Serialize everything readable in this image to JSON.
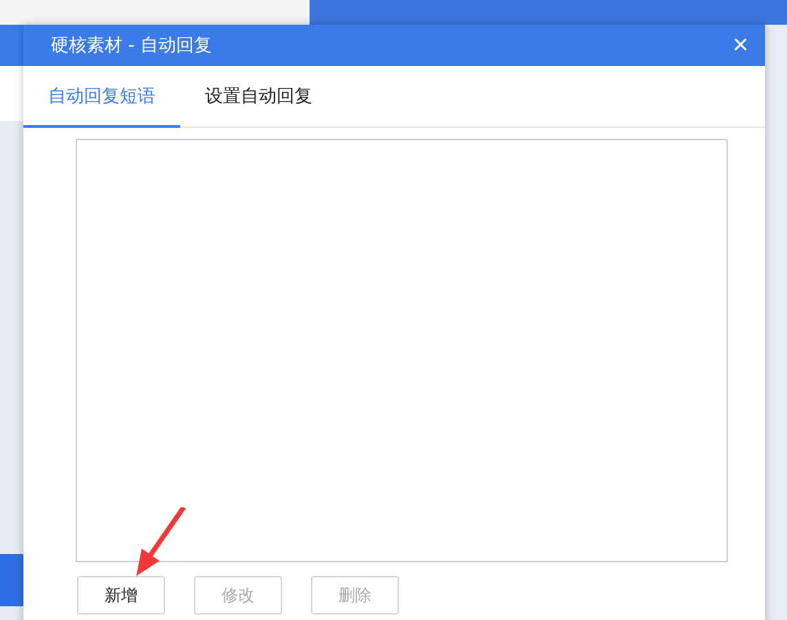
{
  "dialog": {
    "title": "硬核素材 - 自动回复",
    "close": "×"
  },
  "tabs": [
    {
      "label": "自动回复短语",
      "selected": true
    },
    {
      "label": "设置自动回复",
      "selected": false
    }
  ],
  "buttons": [
    {
      "label": "新增",
      "disabled": false
    },
    {
      "label": "修改",
      "disabled": true
    },
    {
      "label": "删除",
      "disabled": true
    }
  ]
}
